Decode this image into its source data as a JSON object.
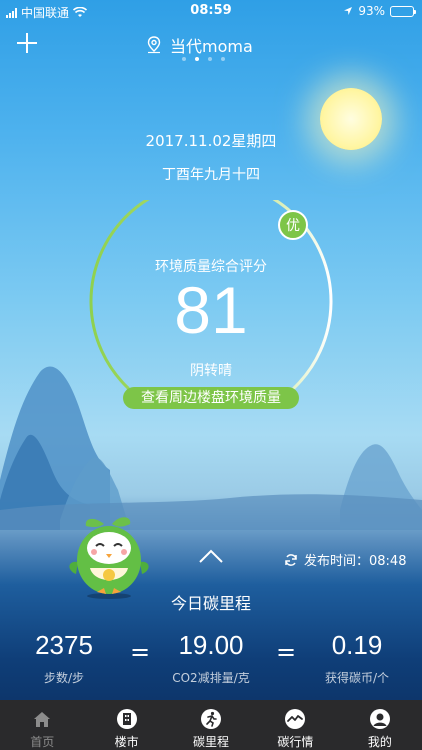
{
  "status": {
    "carrier": "中国联通",
    "time": "08:59",
    "battery": "93%",
    "battery_level": 0.93
  },
  "header": {
    "location": "当代moma",
    "page_dots": 4,
    "active_dot": 1
  },
  "date": {
    "gregorian": "2017.11.02星期四",
    "lunar": "丁酉年九月十四"
  },
  "environment": {
    "score_label": "环境质量综合评分",
    "score": "81",
    "quality_badge": "优",
    "weather": "阴转晴",
    "check_button": "查看周边楼盘环境质量"
  },
  "panel": {
    "publish_label": "发布时间：08:48",
    "today_title": "今日碳里程"
  },
  "stats": [
    {
      "value": "2375",
      "label": "步数/步"
    },
    {
      "value": "19.00",
      "label": "CO2减排量/克"
    },
    {
      "value": "0.19",
      "label": "获得碳币/个"
    }
  ],
  "equals": "=",
  "tabs": [
    {
      "label": "首页",
      "icon": "home-icon"
    },
    {
      "label": "楼市",
      "icon": "building-icon"
    },
    {
      "label": "碳里程",
      "icon": "runner-icon"
    },
    {
      "label": "碳行情",
      "icon": "trend-icon"
    },
    {
      "label": "我的",
      "icon": "user-icon"
    }
  ],
  "colors": {
    "accent_green": "#7dc548",
    "tabbar": "#2a2a2c"
  }
}
